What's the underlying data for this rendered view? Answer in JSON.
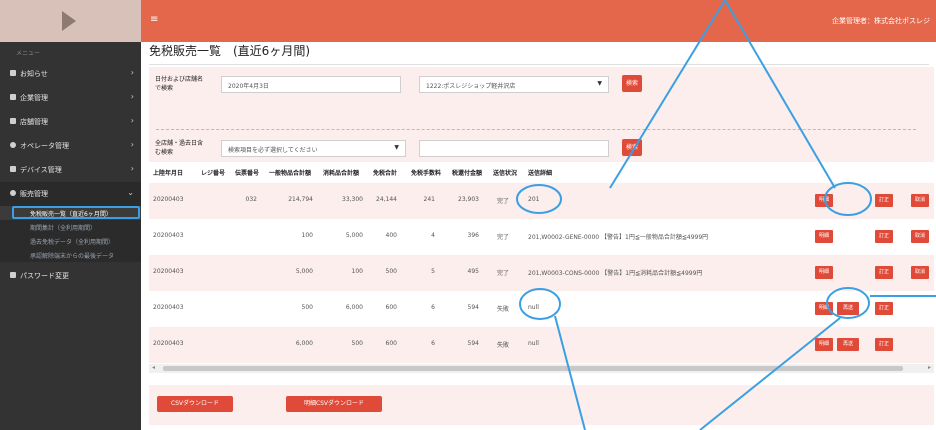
{
  "header": {
    "hamburger": "≡",
    "company": "企業管理者：株式会社ポスレジ"
  },
  "sidebar": {
    "caption": "メニュー",
    "items": [
      {
        "label": "お知らせ",
        "chev": "›"
      },
      {
        "label": "企業管理",
        "chev": "›"
      },
      {
        "label": "店舗管理",
        "chev": "›"
      },
      {
        "label": "オペレータ管理",
        "chev": "›"
      },
      {
        "label": "デバイス管理",
        "chev": "›"
      },
      {
        "label": "販売管理",
        "chev": "⌄"
      }
    ],
    "sub_items": [
      {
        "label": "免税販売一覧（直近6ヶ月間）"
      },
      {
        "label": "期間集計（全利用期間）"
      },
      {
        "label": "過去免税データ（全利用期間）"
      },
      {
        "label": "承認解除端末からの最後データ"
      }
    ],
    "password": "パスワード変更"
  },
  "main": {
    "title": "免税販売一覧　(直近6ヶ月間)",
    "search": {
      "label1": "日付および店舗名で検索",
      "date_value": "2020年4月3日",
      "store_value": "1222:ポスレジショップ軽井沢店",
      "search1": "検索",
      "label2": "全店舗・過去日含む検索",
      "item_placeholder": "検索項目を必ず選択してください",
      "search2": "検索"
    },
    "table": {
      "headers": [
        "上陸年月日",
        "レジ番号",
        "伝票番号",
        "一般物品合計額",
        "消耗品合計額",
        "免税合計",
        "免税手数料",
        "税還付金額",
        "送信状況",
        "送信詳細"
      ],
      "rows": [
        {
          "date": "20200403",
          "register": "",
          "slip": "032",
          "general": "214,794",
          "consumable": "33,300",
          "taxfree": "24,144",
          "fee": "241",
          "refund": "23,903",
          "status": "完了",
          "detail": "201",
          "buttons": [
            "明細",
            "",
            "訂正",
            "取消"
          ]
        },
        {
          "date": "20200403",
          "register": "",
          "slip": "",
          "general": "100",
          "consumable": "5,000",
          "taxfree": "400",
          "fee": "4",
          "refund": "396",
          "status": "完了",
          "detail": "201,W0002-GENE-0000 【警告】1円≦一般物品合計額≦4999円",
          "buttons": [
            "明細",
            "",
            "訂正",
            "取消"
          ]
        },
        {
          "date": "20200403",
          "register": "",
          "slip": "",
          "general": "5,000",
          "consumable": "100",
          "taxfree": "500",
          "fee": "5",
          "refund": "495",
          "status": "完了",
          "detail": "201,W0003-CONS-0000 【警告】1円≦消耗品合計額≦4999円",
          "buttons": [
            "明細",
            "",
            "訂正",
            "取消"
          ]
        },
        {
          "date": "20200403",
          "register": "",
          "slip": "",
          "general": "500",
          "consumable": "6,000",
          "taxfree": "600",
          "fee": "6",
          "refund": "594",
          "status": "失敗",
          "detail": "null",
          "buttons": [
            "明細",
            "再送",
            "訂正",
            ""
          ]
        },
        {
          "date": "20200403",
          "register": "",
          "slip": "",
          "general": "6,000",
          "consumable": "500",
          "taxfree": "600",
          "fee": "6",
          "refund": "594",
          "status": "失敗",
          "detail": "null",
          "buttons": [
            "明細",
            "再送",
            "訂正",
            ""
          ]
        }
      ]
    },
    "scroll": {
      "left": "◂",
      "right": "▸"
    },
    "footer": {
      "csv": "CSVダウンロード",
      "detail_csv": "明細CSVダウンロード"
    }
  },
  "colors": {
    "topbar": "#e4674c",
    "accent_button": "#e04a38",
    "sidebar": "#333333",
    "panel": "#fbeeed",
    "annotation": "#3b9fe3"
  }
}
